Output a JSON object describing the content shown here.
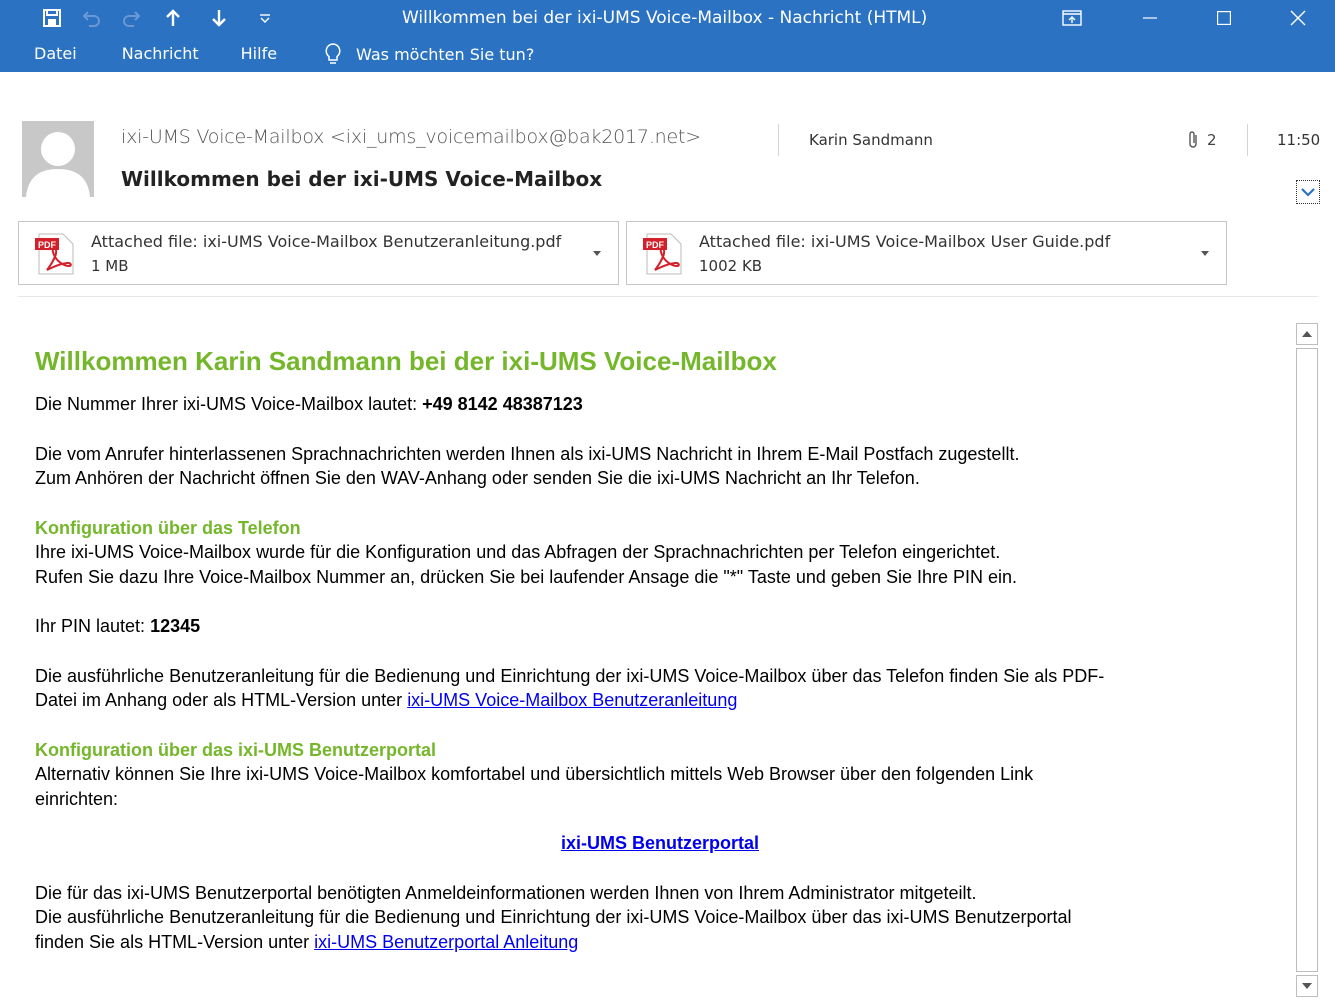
{
  "window": {
    "title": "Willkommen bei der ixi-UMS Voice-Mailbox  -  Nachricht (HTML)"
  },
  "quick_access": {
    "icons": [
      "save-icon",
      "undo-icon",
      "redo-icon",
      "arrow-up-icon",
      "arrow-down-icon",
      "customize-qat-icon"
    ]
  },
  "menu": {
    "items": [
      "Datei",
      "Nachricht",
      "Hilfe"
    ],
    "tell_me": "Was möchten Sie tun?"
  },
  "header": {
    "from": "ixi-UMS Voice-Mailbox <ixi_ums_voicemailbox@bak2017.net>",
    "to": "Karin Sandmann",
    "attachment_count": "2",
    "time": "11:50",
    "subject": "Willkommen bei der ixi-UMS Voice-Mailbox"
  },
  "attachments": [
    {
      "name": "Attached file: ixi-UMS Voice-Mailbox Benutzeranleitung.pdf",
      "size": "1 MB",
      "icon_label": "PDF"
    },
    {
      "name": "Attached file: ixi-UMS Voice-Mailbox User Guide.pdf",
      "size": "1002 KB",
      "icon_label": "PDF"
    }
  ],
  "body": {
    "heading": "Willkommen Karin Sandmann bei der ixi-UMS Voice-Mailbox",
    "number_label": "Die Nummer Ihrer ixi-UMS Voice-Mailbox lautet: ",
    "number_value": "+49 8142 48387123",
    "intro_line1": "Die vom Anrufer hinterlassenen Sprachnachrichten werden Ihnen als ixi-UMS Nachricht in Ihrem E-Mail Postfach zugestellt.",
    "intro_line2": "Zum Anhören der Nachricht öffnen Sie den WAV-Anhang oder senden Sie die ixi-UMS Nachricht an Ihr Telefon.",
    "phone_heading": "Konfiguration über das Telefon",
    "phone_line1": "Ihre ixi-UMS Voice-Mailbox wurde für die Konfiguration und das Abfragen der Sprachnachrichten per Telefon eingerichtet.",
    "phone_line2": "Rufen Sie dazu Ihre Voice-Mailbox Nummer an, drücken Sie bei laufender Ansage die \"*\" Taste und geben Sie Ihre PIN ein.",
    "pin_label": "Ihr PIN lautet: ",
    "pin_value": "12345",
    "manual_line1": "Die ausführliche Benutzeranleitung für die Bedienung und Einrichtung der ixi-UMS Voice-Mailbox über das Telefon finden Sie als PDF-",
    "manual_line2_prefix": "Datei im Anhang oder als HTML-Version unter ",
    "manual_link": "ixi-UMS Voice-Mailbox Benutzeranleitung",
    "portal_heading": "Konfiguration über das ixi-UMS Benutzerportal",
    "portal_line1": "Alternativ können Sie Ihre ixi-UMS Voice-Mailbox komfortabel und übersichtlich mittels Web Browser über den folgenden Link",
    "portal_line2": "einrichten:",
    "portal_link": "ixi-UMS Benutzerportal",
    "footer_line1": "Die für das ixi-UMS Benutzerportal benötigten Anmeldeinformationen werden Ihnen von Ihrem Administrator mitgeteilt.",
    "footer_line2": "Die ausführliche Benutzeranleitung für die Bedienung und Einrichtung der ixi-UMS Voice-Mailbox über das ixi-UMS Benutzerportal",
    "footer_line3_prefix": "finden Sie als HTML-Version unter ",
    "footer_link": "ixi-UMS Benutzerportal Anleitung"
  },
  "colors": {
    "titlebar": "#2b72c3",
    "heading_green": "#75b72b",
    "link_blue": "#0000ee",
    "pdf_red": "#d3202a"
  }
}
